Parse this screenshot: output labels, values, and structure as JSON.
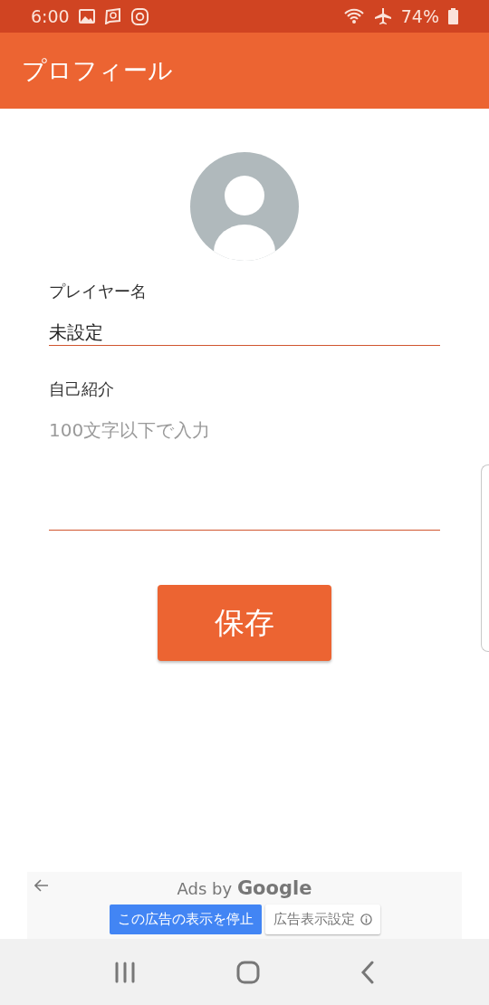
{
  "status_bar": {
    "time": "6:00",
    "battery": "74%"
  },
  "app_bar": {
    "title": "プロフィール"
  },
  "form": {
    "fields": [
      {
        "label": "プレイヤー名",
        "value": "未設定",
        "kind": "line"
      },
      {
        "label": "自己紹介",
        "placeholder": "100文字以下で入力",
        "kind": "area"
      }
    ],
    "save_button": "保存"
  },
  "ad": {
    "attribution": "Ads by **Google**",
    "stop_button": "この広告の表示を停止",
    "settings_button": "広告表示設定"
  }
}
